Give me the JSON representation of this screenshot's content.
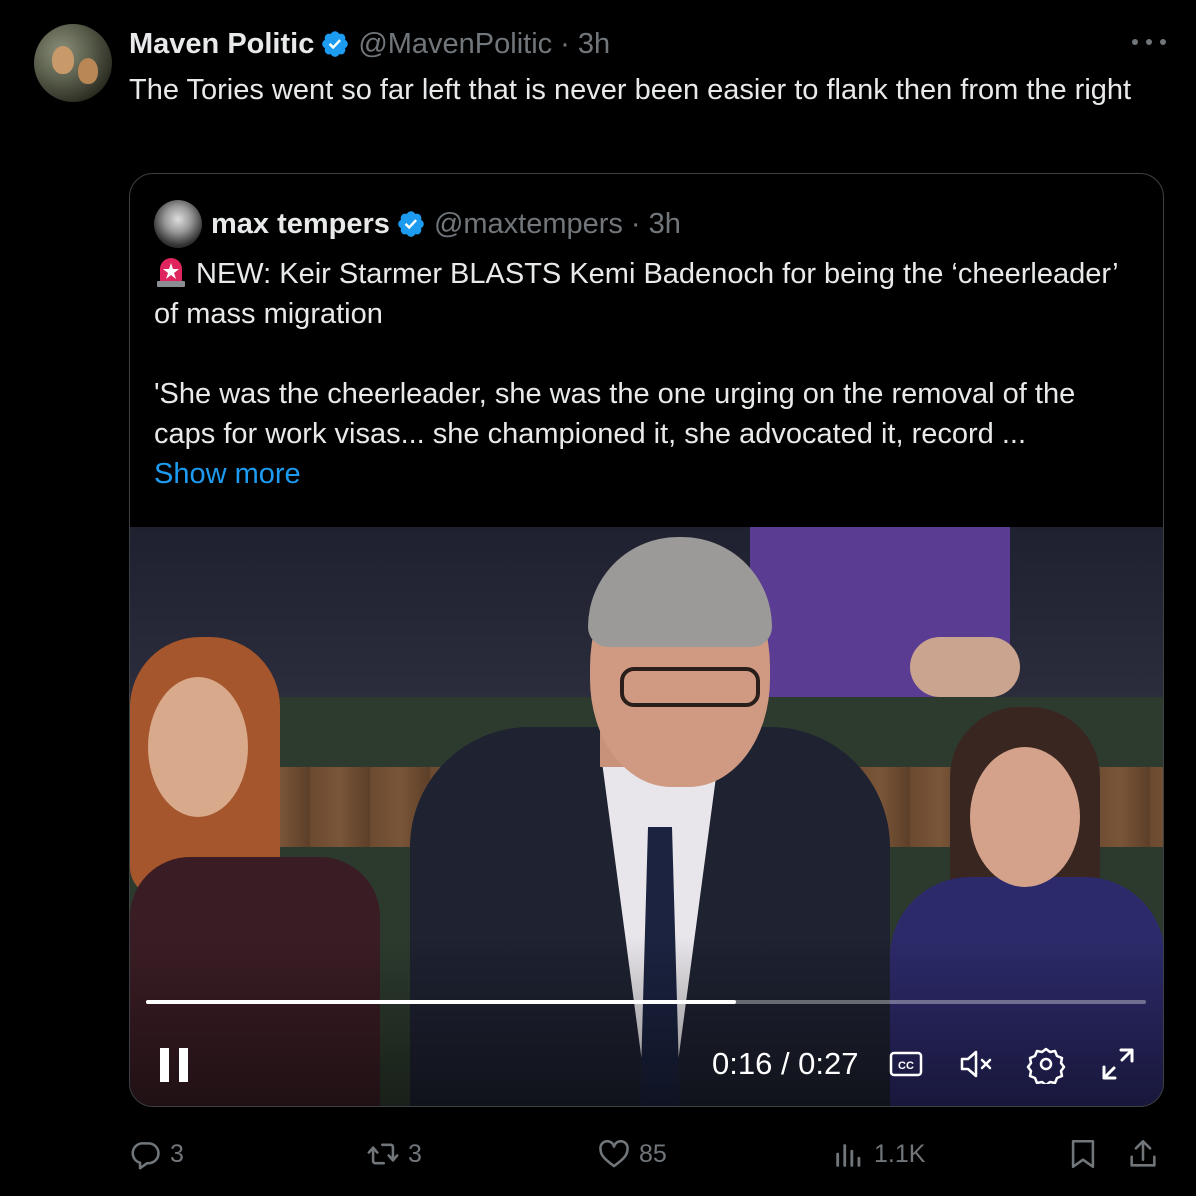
{
  "tweet": {
    "author_name": "Maven Politic",
    "author_handle": "@MavenPolitic",
    "separator": "·",
    "time": "3h",
    "text": "The Tories went so far left that is never been easier to flank then from the right",
    "more_icon": "more-horizontal-icon",
    "verified_color": "#1d9bf0"
  },
  "quote": {
    "author_name": "max tempers",
    "author_handle": "@maxtempers",
    "separator": "·",
    "time": "3h",
    "line1": "NEW: Keir Starmer BLASTS Kemi Badenoch for being the ‘cheerleader’ of mass migration",
    "line2": "'She was the cheerleader, she was the one urging on the removal of the caps for work visas... she championed it, she advocated it, record ...",
    "show_more": "Show more",
    "siren_icon": "police-siren-emoji"
  },
  "video": {
    "progress": 0.59,
    "current_time": "0:16",
    "duration": "0:27",
    "timecode": "0:16 / 0:27",
    "state": "playing",
    "icons": [
      "pause-icon",
      "captions-icon",
      "muted-volume-icon",
      "settings-icon",
      "fullscreen-icon"
    ]
  },
  "actions": {
    "replies": "3",
    "reposts": "3",
    "likes": "85",
    "views": "1.1K",
    "icons": [
      "reply-icon",
      "repost-icon",
      "like-icon",
      "views-icon",
      "bookmark-icon",
      "share-icon"
    ]
  },
  "colors": {
    "background": "#000000",
    "text_primary": "#e7e9ea",
    "text_secondary": "#71767b",
    "accent": "#1d9bf0",
    "border": "#3e4144"
  }
}
